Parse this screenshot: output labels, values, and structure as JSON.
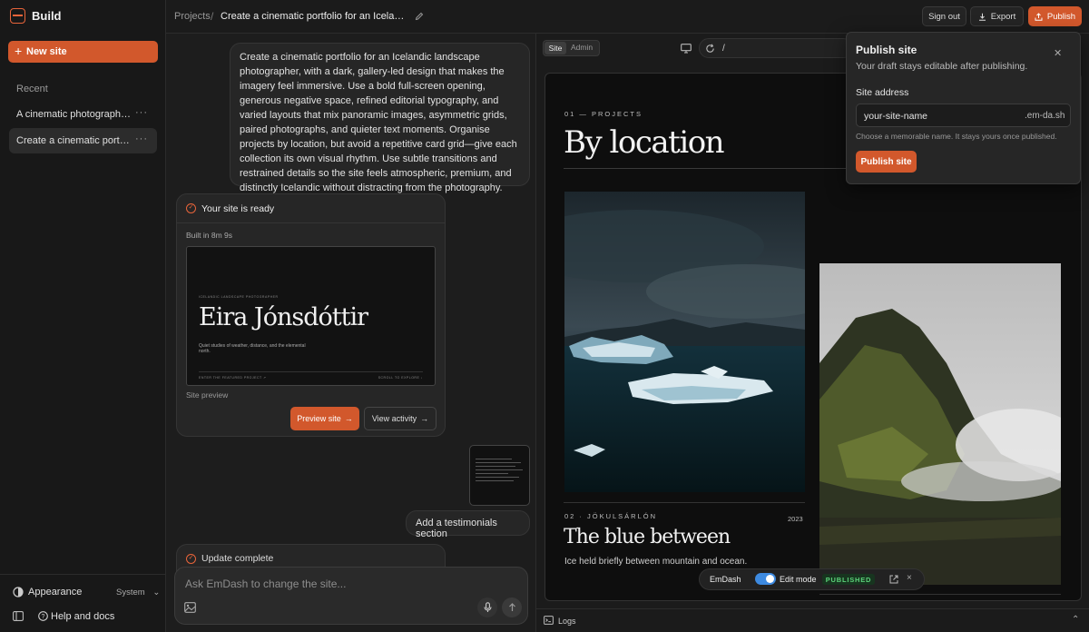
{
  "sidebar": {
    "brand": "Build",
    "new_site_label": "New site",
    "recent_heading": "Recent",
    "history": [
      {
        "label": "A cinematic photography ..."
      },
      {
        "label": "Create a cinematic portfol..."
      }
    ],
    "appearance_label": "Appearance",
    "appearance_value": "System",
    "help_label": "Help and docs"
  },
  "header": {
    "breadcrumb_root": "Projects",
    "breadcrumb_separator": "/",
    "project_title": "Create a cinematic portfolio for an Icelandic...",
    "sign_out_label": "Sign out",
    "export_label": "Export",
    "publish_label": "Publish"
  },
  "chat": {
    "prompt": "Create a cinematic portfolio for an Icelandic landscape photographer, with a dark, gallery-led design that makes the imagery feel immersive. Use a bold full-screen opening, generous negative space, refined editorial typography, and varied layouts that mix panoramic images, asymmetric grids, paired photographs, and quieter text moments. Organise projects by location, but avoid a repetitive card grid—give each collection its own visual rhythm. Use subtle transitions and restrained details so the site feels atmospheric, premium, and distinctly Icelandic without distracting from the photography.",
    "ready_title": "Your site is ready",
    "built_time": "Built in 8m 9s",
    "thumbnail": {
      "kicker": "ICELANDIC LANDSCAPE PHOTOGRAPHER",
      "name": "Eira Jónsdóttir",
      "tagline": "Quiet studies of weather, distance, and the elemental north.",
      "cta_left": "ENTER THE FEATURED PROJECT ↗",
      "cta_right": "SCROLL TO EXPLORE ↓"
    },
    "preview_caption": "Site preview",
    "preview_button": "Preview site",
    "activity_button": "View activity",
    "user_message": "Add a testimonials section",
    "update_title": "Update complete",
    "composer_placeholder": "Ask EmDash to change the site..."
  },
  "preview": {
    "tabs": [
      "Site",
      "Admin"
    ],
    "active_tab": "Site",
    "url_path": "/",
    "site": {
      "eyebrow": "01 — PROJECTS",
      "heading": "By location",
      "location_label": "02 · JÖKULSÁRLÓN",
      "year": "2023",
      "project_title": "The blue between",
      "caption": "Ice held briefly between mountain and ocean."
    },
    "toolbar": {
      "brand": "EmDash",
      "edit_mode_label": "Edit mode",
      "edit_mode_on": true,
      "status": "PUBLISHED"
    },
    "logs_label": "Logs"
  },
  "publish_popover": {
    "title": "Publish site",
    "description": "Your draft stays editable after publishing.",
    "address_label": "Site address",
    "address_value": "your-site-name",
    "address_suffix": ".em-da.sh",
    "help_text": "Choose a memorable name. It stays yours once published.",
    "submit_label": "Publish site"
  },
  "colors": {
    "accent": "#d2582c",
    "background": "#1d1d1d",
    "published_green": "#5cd27a",
    "toggle_blue": "#3d8ae0"
  }
}
